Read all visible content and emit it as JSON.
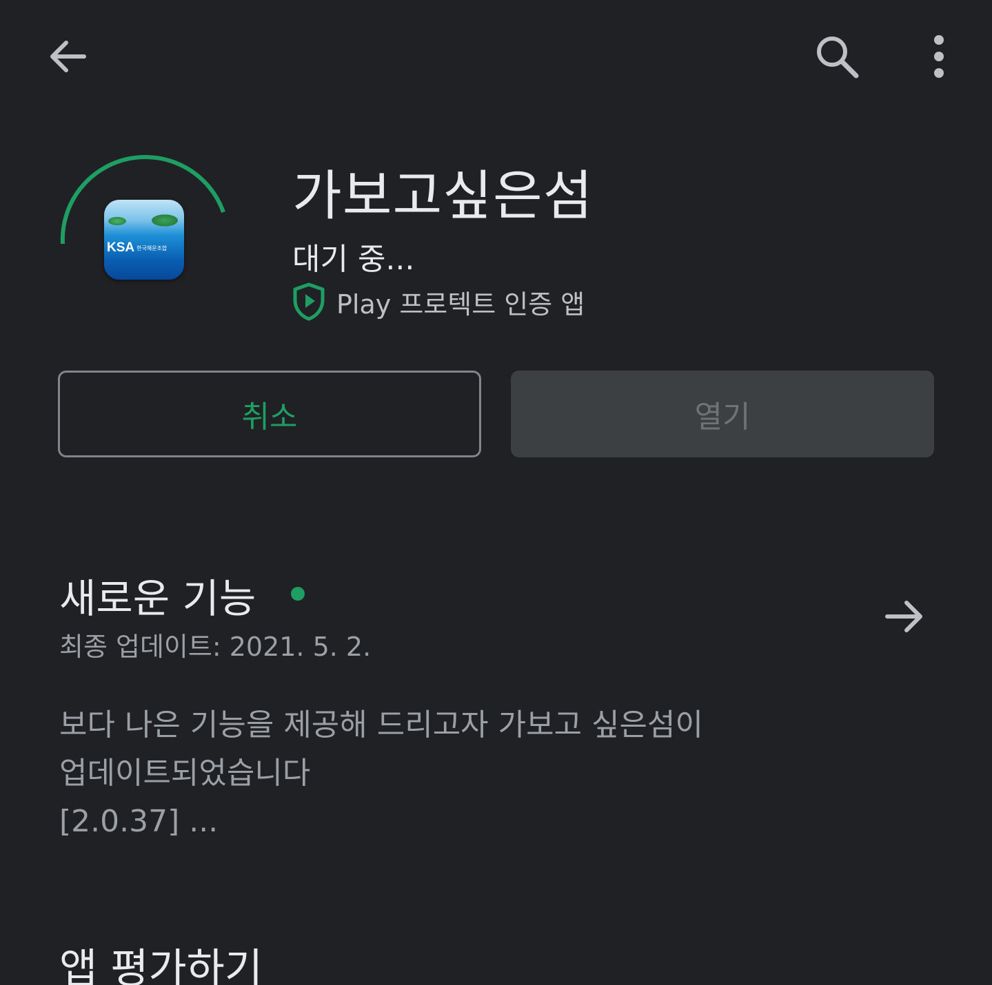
{
  "topbar": {
    "back_icon": "arrow-back-icon",
    "search_icon": "search-icon",
    "more_icon": "more-vert-icon"
  },
  "app": {
    "name": "가보고싶은섬",
    "status": "대기 중...",
    "icon_text": "KSA",
    "icon_subtext": "한국해운조합",
    "protect_label": "Play 프로텍트 인증 앱",
    "protect_icon": "play-protect-shield-icon"
  },
  "actions": {
    "cancel_label": "취소",
    "open_label": "열기"
  },
  "whats_new": {
    "title": "새로운 기능",
    "updated": "최종 업데이트: 2021. 5. 2.",
    "notes": [
      "보다 나은 기능을 제공해 드리고자 가보고 싶은섬이",
      "업데이트되었습니다",
      "[2.0.37] ..."
    ]
  },
  "rate": {
    "title": "앱 평가하기"
  },
  "colors": {
    "background": "#202124",
    "accent_green": "#1e9e63",
    "text_primary": "#e8eaed",
    "text_secondary": "#9aa0a6",
    "disabled_button": "#3c4043"
  }
}
